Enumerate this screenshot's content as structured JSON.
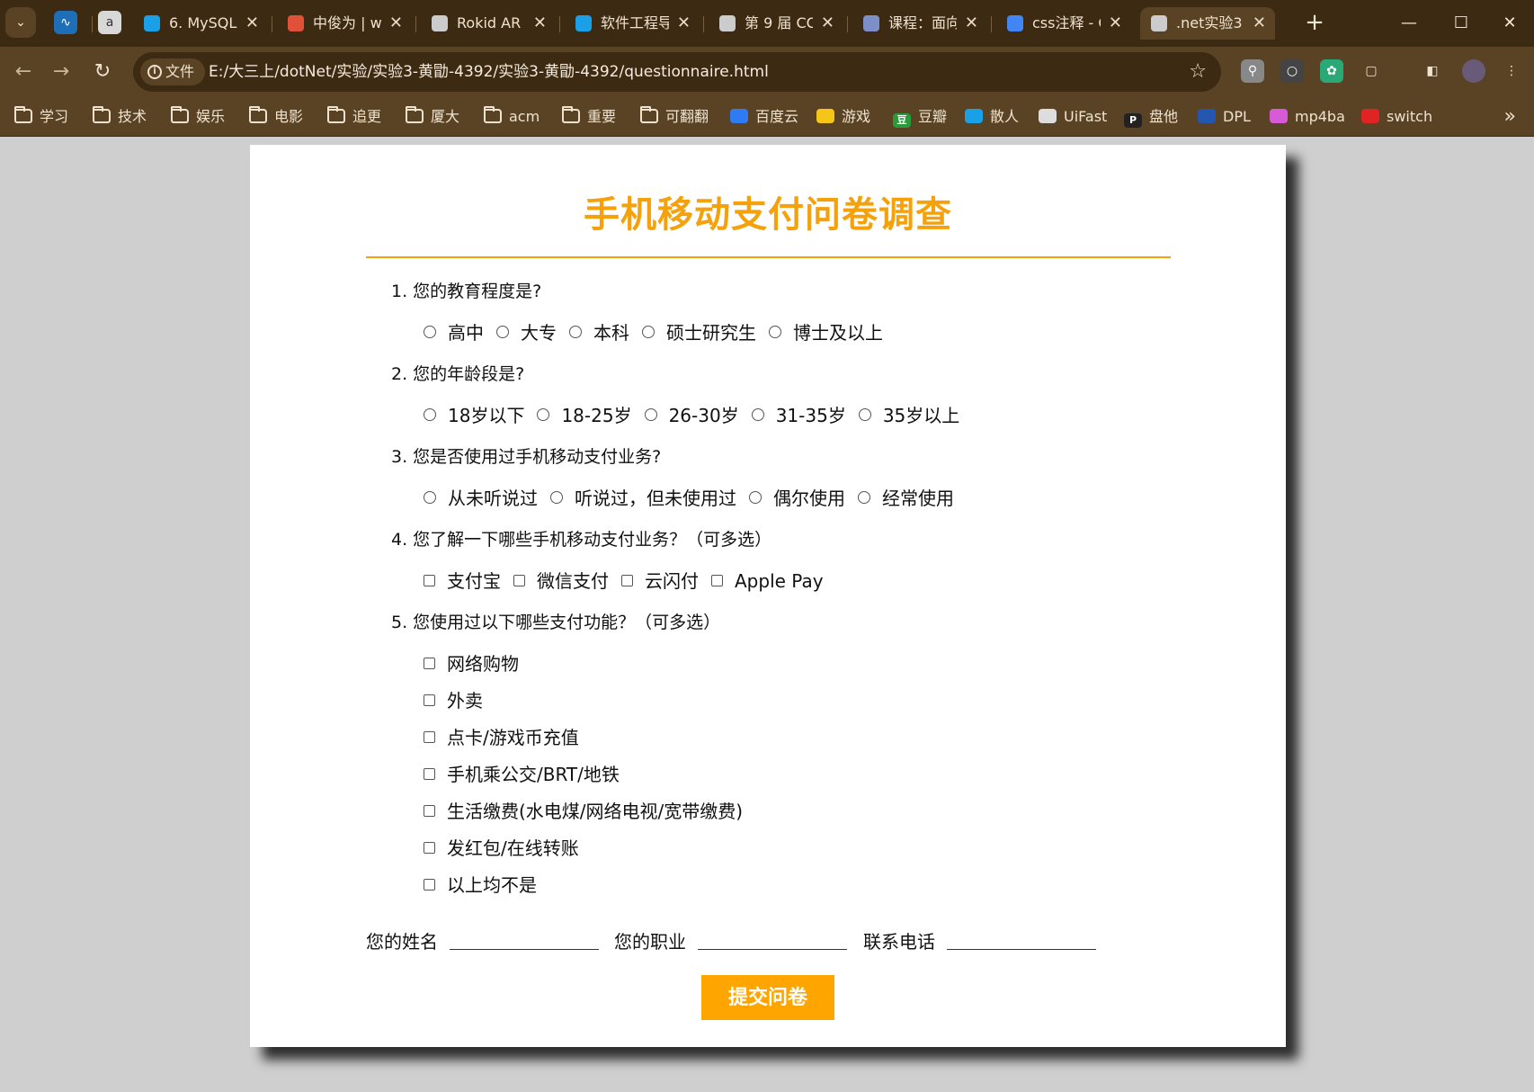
{
  "browser": {
    "tabs": [
      {
        "title": "6. MySQL",
        "favicon_color": "#1aa0e6",
        "favicon": "bilibili-icon"
      },
      {
        "title": "中俊为 | w",
        "favicon_color": "#e0513a",
        "favicon": "leaf-icon"
      },
      {
        "title": "Rokid AR",
        "favicon_color": "#cccccc",
        "favicon": "globe-icon"
      },
      {
        "title": "软件工程导",
        "favicon_color": "#1aa0e6",
        "favicon": "bilibili-icon"
      },
      {
        "title": "第 9 届 CC",
        "favicon_color": "#cccccc",
        "favicon": "balloon-icon"
      },
      {
        "title": "课程：面向",
        "favicon_color": "#7d8fc8",
        "favicon": "course-icon"
      },
      {
        "title": "css注释 - C",
        "favicon_color": "#4285f4",
        "favicon": "google-icon"
      },
      {
        "title": ".net实验3",
        "favicon_color": "#cccccc",
        "favicon": "globe-icon"
      }
    ],
    "close_glyph": "✕",
    "new_tab_glyph": "+",
    "address": {
      "scheme_label": "文件",
      "url": "E:/大三上/dotNet/实验/实验3-黄勖-4392/实验3-黄勖-4392/questionnaire.html"
    },
    "bookmarks": [
      {
        "label": "学习",
        "type": "folder"
      },
      {
        "label": "技术",
        "type": "folder"
      },
      {
        "label": "娱乐",
        "type": "folder"
      },
      {
        "label": "电影",
        "type": "folder"
      },
      {
        "label": "追更",
        "type": "folder"
      },
      {
        "label": "厦大",
        "type": "folder"
      },
      {
        "label": "acm",
        "type": "folder"
      },
      {
        "label": "重要",
        "type": "folder"
      },
      {
        "label": "可翻翻",
        "type": "folder"
      },
      {
        "label": "百度云",
        "type": "site",
        "color": "#2f7bf6"
      },
      {
        "label": "游戏",
        "type": "site",
        "color": "#f5c518"
      },
      {
        "label": "豆瓣",
        "type": "site",
        "color": "#2a9a3b",
        "glyph": "豆"
      },
      {
        "label": "散人",
        "type": "site",
        "color": "#1aa0e6"
      },
      {
        "label": "UiFast",
        "type": "site",
        "color": "#dddddd"
      },
      {
        "label": "盘他",
        "type": "site",
        "color": "#222222",
        "glyph": "P"
      },
      {
        "label": "DPL",
        "type": "site",
        "color": "#2456b0"
      },
      {
        "label": "mp4ba",
        "type": "site",
        "color": "#d65ad6"
      },
      {
        "label": "switch",
        "type": "site",
        "color": "#e02424"
      }
    ]
  },
  "survey": {
    "title": "手机移动支付问卷调查",
    "questions": [
      {
        "text": "1. 您的教育程度是?",
        "type": "radio",
        "options": [
          "高中",
          "大专",
          "本科",
          "硕士研究生",
          "博士及以上"
        ]
      },
      {
        "text": "2. 您的年龄段是?",
        "type": "radio",
        "options": [
          "18岁以下",
          "18-25岁",
          "26-30岁",
          "31-35岁",
          "35岁以上"
        ]
      },
      {
        "text": "3. 您是否使用过手机移动支付业务?",
        "type": "radio",
        "options": [
          "从未听说过",
          "听说过，但未使用过",
          "偶尔使用",
          "经常使用"
        ]
      },
      {
        "text": "4. 您了解一下哪些手机移动支付业务？（可多选）",
        "type": "checkbox",
        "options": [
          "支付宝",
          "微信支付",
          "云闪付",
          "Apple Pay"
        ]
      },
      {
        "text": "5. 您使用过以下哪些支付功能？（可多选）",
        "type": "checkbox",
        "options": [
          "网络购物",
          "外卖",
          "点卡/游戏币充值",
          "手机乘公交/BRT/地铁",
          "生活缴费(水电煤/网络电视/宽带缴费)",
          "发红包/在线转账",
          "以上均不是"
        ]
      }
    ],
    "fields": [
      {
        "label": "您的姓名",
        "value": ""
      },
      {
        "label": "您的职业",
        "value": ""
      },
      {
        "label": "联系电话",
        "value": ""
      }
    ],
    "submit_label": "提交问卷",
    "accent_color": "#f5a10b",
    "button_color": "#ffa500"
  }
}
